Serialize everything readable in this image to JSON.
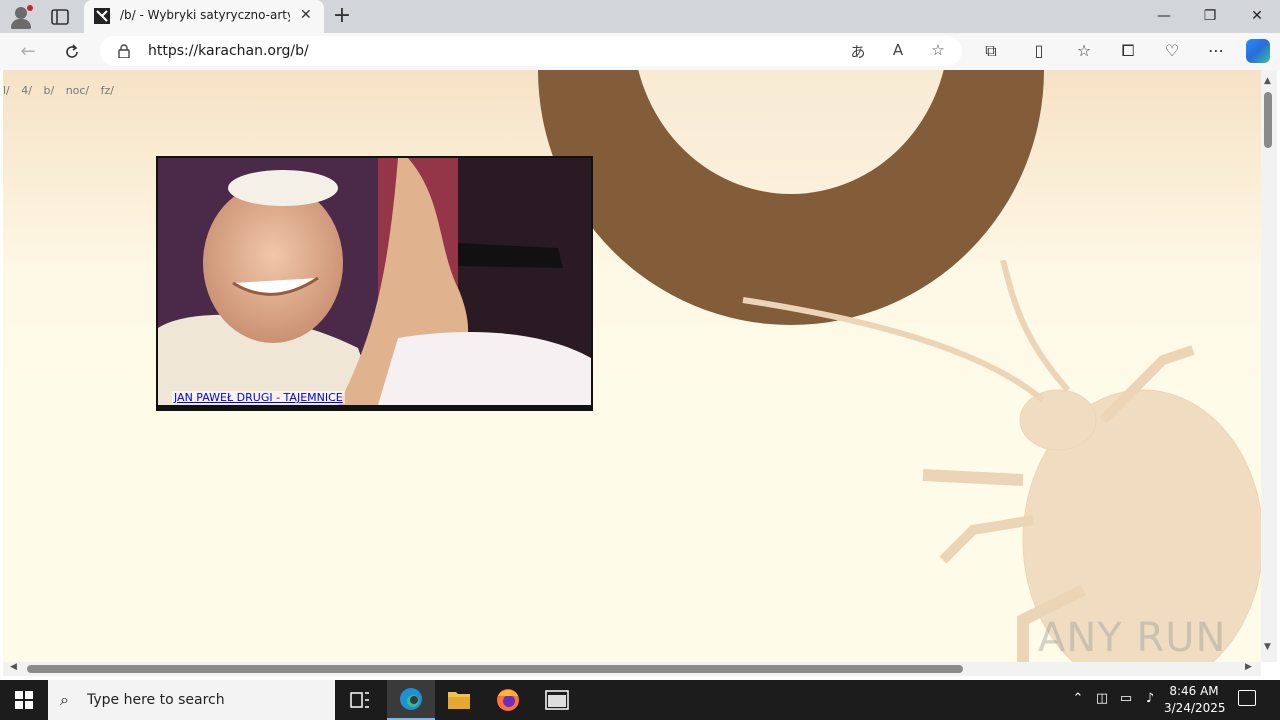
{
  "browser": {
    "tab_title": "/b/ - Wybryki satyryczno-artystyczne",
    "tab_close": "✕",
    "new_tab": "+",
    "url": "https://karachan.org/b/",
    "window_controls": {
      "minimize": "—",
      "restore": "❐",
      "close": "✕"
    }
  },
  "page": {
    "board_links": [
      "l/",
      "4/",
      "b/",
      "noc/",
      "fz/"
    ],
    "banner_caption": "JAN PAWEŁ DRUGI - TAJEMNICE",
    "watermark": "ANY RUN"
  },
  "taskbar": {
    "search_placeholder": "Type here to search",
    "time": "8:46 AM",
    "date": "3/24/2025"
  },
  "colors": {
    "page_background": "#fffbe9",
    "ring": "#835c3a",
    "link": "#0000ee",
    "taskbar": "#1c1c1c"
  }
}
